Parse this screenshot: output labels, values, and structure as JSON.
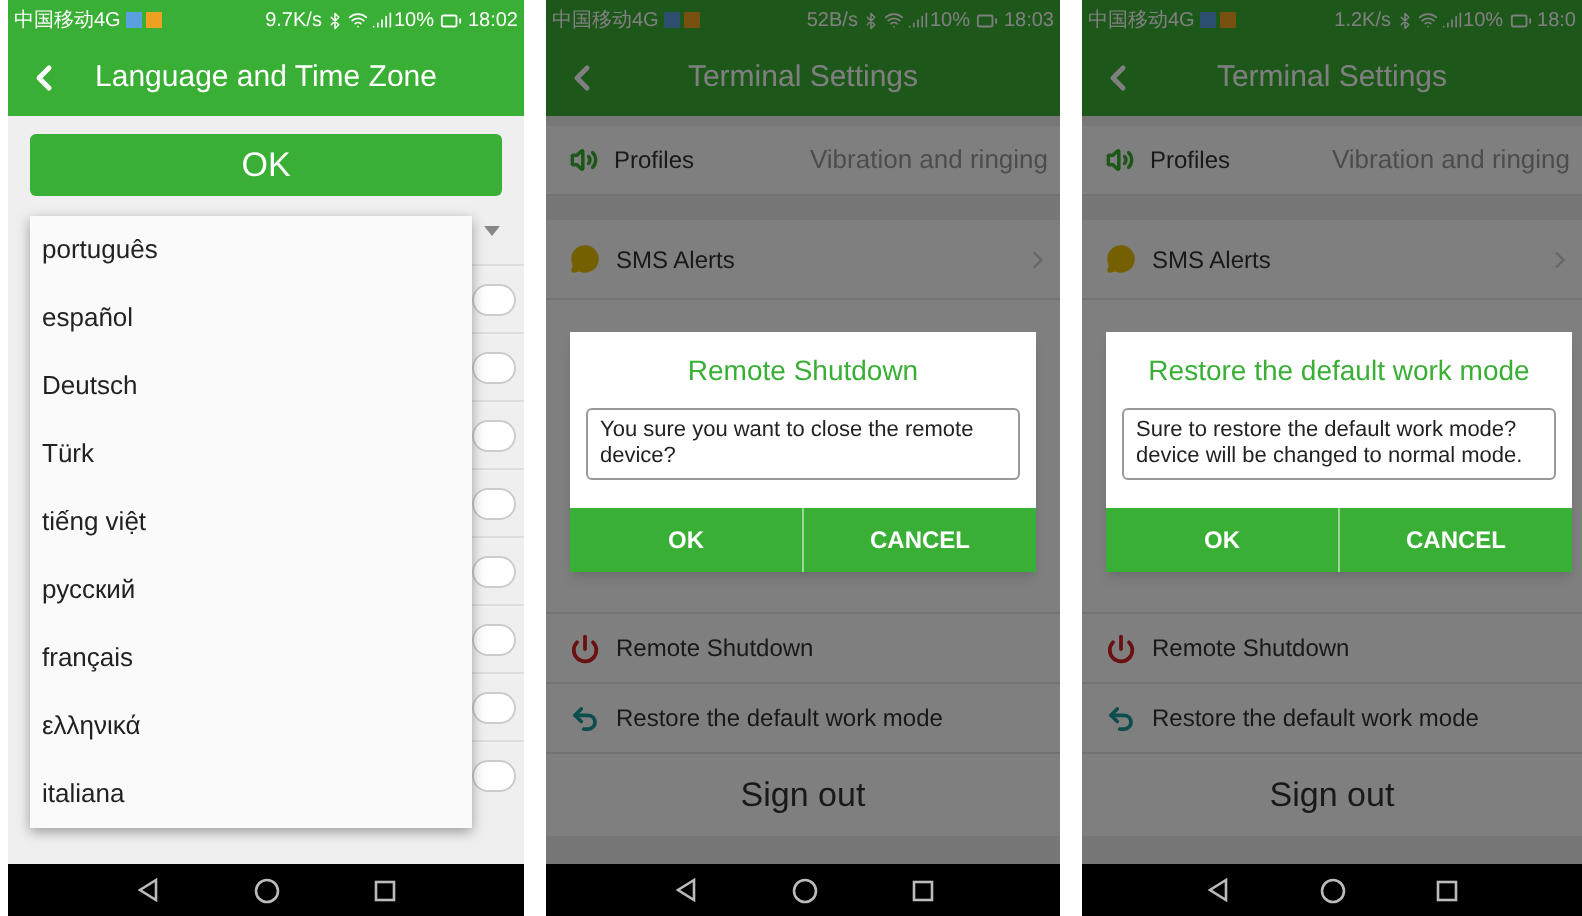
{
  "screens": [
    {
      "kind": "language",
      "status_bar": {
        "carrier": "中国移动4G",
        "speed": "9.7K/s",
        "battery": "10%",
        "time": "18:02"
      },
      "header": {
        "title": "Language and Time Zone"
      },
      "ok_button": "OK",
      "languages": [
        {
          "label": "português"
        },
        {
          "label": "español"
        },
        {
          "label": "Deutsch"
        },
        {
          "label": "Türk"
        },
        {
          "label": "tiếng việt"
        },
        {
          "label": "русский"
        },
        {
          "label": "français"
        },
        {
          "label": "ελληνικά"
        },
        {
          "label": "italiana"
        }
      ]
    },
    {
      "kind": "settings",
      "status_bar": {
        "carrier": "中国移动4G",
        "speed": "52B/s",
        "battery": "10%",
        "time": "18:03"
      },
      "header": {
        "title": "Terminal Settings"
      },
      "settings": [
        {
          "kind": "profiles",
          "label": "Profiles",
          "value": "Vibration and ringing"
        },
        {
          "kind": "sms",
          "label": "SMS Alerts"
        }
      ],
      "actions": [
        {
          "kind": "shutdown",
          "label": "Remote Shutdown"
        },
        {
          "kind": "restore",
          "label": "Restore the default work mode"
        }
      ],
      "sign_out": "Sign out",
      "dialog": {
        "title": "Remote Shutdown",
        "message": "You sure you want to close the remote device?",
        "buttons": [
          "OK",
          "CANCEL"
        ]
      }
    },
    {
      "kind": "settings",
      "status_bar": {
        "carrier": "中国移动4G",
        "speed": "1.2K/s",
        "battery": "10%",
        "time": "18:0"
      },
      "header": {
        "title": "Terminal Settings"
      },
      "settings": [
        {
          "kind": "profiles",
          "label": "Profiles",
          "value": "Vibration and ringing"
        },
        {
          "kind": "sms",
          "label": "SMS Alerts"
        }
      ],
      "actions": [
        {
          "kind": "shutdown",
          "label": "Remote Shutdown"
        },
        {
          "kind": "restore",
          "label": "Restore the default work mode"
        }
      ],
      "sign_out": "Sign out",
      "dialog": {
        "title": "Restore the default work mode",
        "message": "Sure to restore the default work mode? device will be changed to normal mode.",
        "buttons": [
          "OK",
          "CANCEL"
        ]
      }
    }
  ]
}
